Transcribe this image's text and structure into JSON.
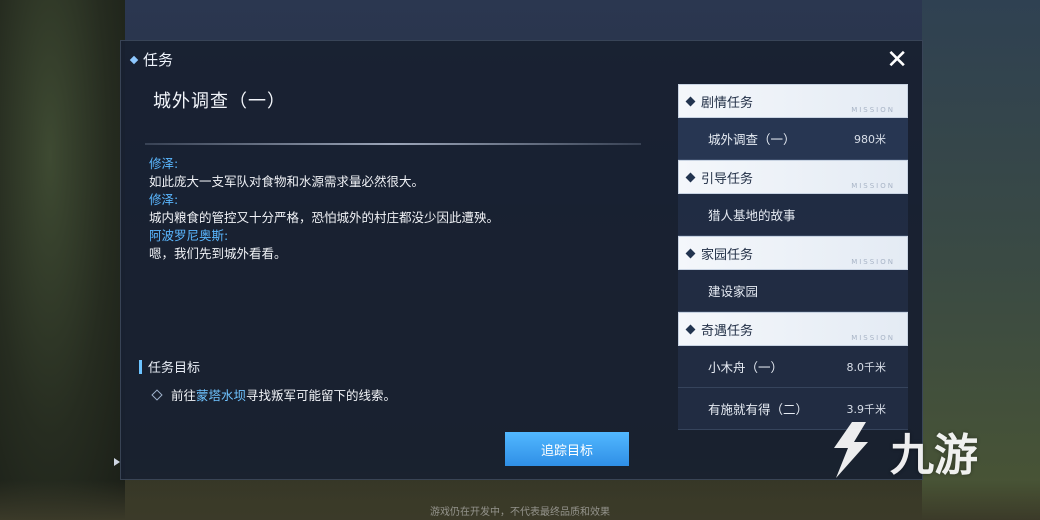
{
  "panel": {
    "title": "任务",
    "close_icon": "close-icon"
  },
  "quest": {
    "title": "城外调查（一）",
    "dialogue": [
      {
        "speaker": "修泽:",
        "text": "如此庞大一支军队对食物和水源需求量必然很大。"
      },
      {
        "speaker": "修泽:",
        "text": "城内粮食的管控又十分严格，恐怕城外的村庄都没少因此遭殃。"
      },
      {
        "speaker": "阿波罗尼奥斯:",
        "text": "嗯，我们先到城外看看。"
      }
    ],
    "goal_header": "任务目标",
    "goal_prefix": "前往",
    "goal_highlight": "蒙塔水坝",
    "goal_suffix": "寻找叛军可能留下的线索。",
    "track_button": "追踪目标"
  },
  "quest_list": {
    "mission_tag": "MISSION",
    "categories": [
      {
        "label": "剧情任务",
        "items": [
          {
            "name": "城外调查（一）",
            "distance": "980米"
          }
        ]
      },
      {
        "label": "引导任务",
        "items": [
          {
            "name": "猎人基地的故事",
            "distance": ""
          }
        ]
      },
      {
        "label": "家园任务",
        "items": [
          {
            "name": "建设家园",
            "distance": ""
          }
        ]
      },
      {
        "label": "奇遇任务",
        "items": [
          {
            "name": "小木舟（一）",
            "distance": "8.0千米"
          },
          {
            "name": "有施就有得（二）",
            "distance": "3.9千米"
          }
        ]
      }
    ]
  },
  "watermark": {
    "text": "九游"
  },
  "footer_note": "游戏仍在开发中，不代表最终品质和效果",
  "colors": {
    "accent": "#5ab7ff",
    "button": "#3fa3f2",
    "panel": "#182030"
  }
}
